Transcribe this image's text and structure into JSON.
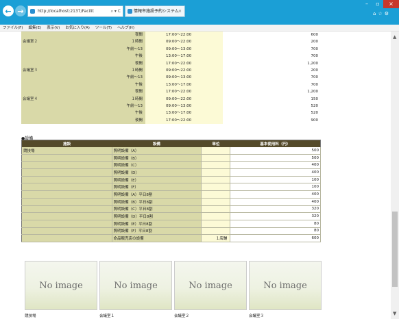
{
  "browser": {
    "address_url": "http://localhost:2137/Facilit",
    "address_tools": "⌕ ▾ C",
    "tab_title": "情報市施設予約システム",
    "tab_close": "×",
    "menu": [
      "ファイル(F)",
      "編集(E)",
      "表示(V)",
      "お気に入り(A)",
      "ツール(T)",
      "ヘルプ(H)"
    ]
  },
  "rooms": [
    {
      "room": "",
      "unit": "夜間",
      "time": "17:00〜22:00",
      "price": "600"
    },
    {
      "room": "会議室２",
      "unit": "１時間",
      "time": "09:00〜22:00",
      "price": "200"
    },
    {
      "room": "",
      "unit": "午前〜13",
      "time": "09:00〜13:00",
      "price": "700"
    },
    {
      "room": "",
      "unit": "午後",
      "time": "13:00〜17:00",
      "price": "700"
    },
    {
      "room": "",
      "unit": "夜間",
      "time": "17:00〜22:00",
      "price": "1,200"
    },
    {
      "room": "会議室３",
      "unit": "１時間",
      "time": "09:00〜22:00",
      "price": "200"
    },
    {
      "room": "",
      "unit": "午前〜13",
      "time": "09:00〜13:00",
      "price": "700"
    },
    {
      "room": "",
      "unit": "午後",
      "time": "13:00〜17:00",
      "price": "700"
    },
    {
      "room": "",
      "unit": "夜間",
      "time": "17:00〜22:00",
      "price": "1,200"
    },
    {
      "room": "会議室４",
      "unit": "１時間",
      "time": "09:00〜22:00",
      "price": "150"
    },
    {
      "room": "",
      "unit": "午前〜13",
      "time": "09:00〜13:00",
      "price": "520"
    },
    {
      "room": "",
      "unit": "午後",
      "time": "13:00〜17:00",
      "price": "520"
    },
    {
      "room": "",
      "unit": "夜間",
      "time": "17:00〜22:00",
      "price": "900"
    }
  ],
  "equipment": {
    "section_title": "●設備",
    "headers": [
      "施設",
      "設備",
      "単位",
      "基本使用料（円）"
    ],
    "rows": [
      {
        "facility": "競技場",
        "name": "照明設備（A）",
        "unit": "",
        "price": "500"
      },
      {
        "facility": "",
        "name": "照明設備（B）",
        "unit": "",
        "price": "500"
      },
      {
        "facility": "",
        "name": "照明設備（C）",
        "unit": "",
        "price": "400"
      },
      {
        "facility": "",
        "name": "照明設備（D）",
        "unit": "",
        "price": "400"
      },
      {
        "facility": "",
        "name": "照明設備（E）",
        "unit": "",
        "price": "100"
      },
      {
        "facility": "",
        "name": "照明設備（F）",
        "unit": "",
        "price": "100"
      },
      {
        "facility": "",
        "name": "照明設備（A）平日8割",
        "unit": "",
        "price": "400"
      },
      {
        "facility": "",
        "name": "照明設備（B）平日8割",
        "unit": "",
        "price": "400"
      },
      {
        "facility": "",
        "name": "照明設備（C）平日8割",
        "unit": "",
        "price": "320"
      },
      {
        "facility": "",
        "name": "照明設備（D）平日8割",
        "unit": "",
        "price": "320"
      },
      {
        "facility": "",
        "name": "照明設備（E）平日8割",
        "unit": "",
        "price": "80"
      },
      {
        "facility": "",
        "name": "照明設備（F）平日8割",
        "unit": "",
        "price": "80"
      },
      {
        "facility": "",
        "name": "命品販売店の設備",
        "unit": "１店舗",
        "price": "600"
      }
    ]
  },
  "cards": [
    {
      "image_text": "No image",
      "caption": "競技場"
    },
    {
      "image_text": "No image",
      "caption": "会議室１"
    },
    {
      "image_text": "No image",
      "caption": "会議室２"
    },
    {
      "image_text": "No image",
      "caption": "会議室３"
    }
  ]
}
